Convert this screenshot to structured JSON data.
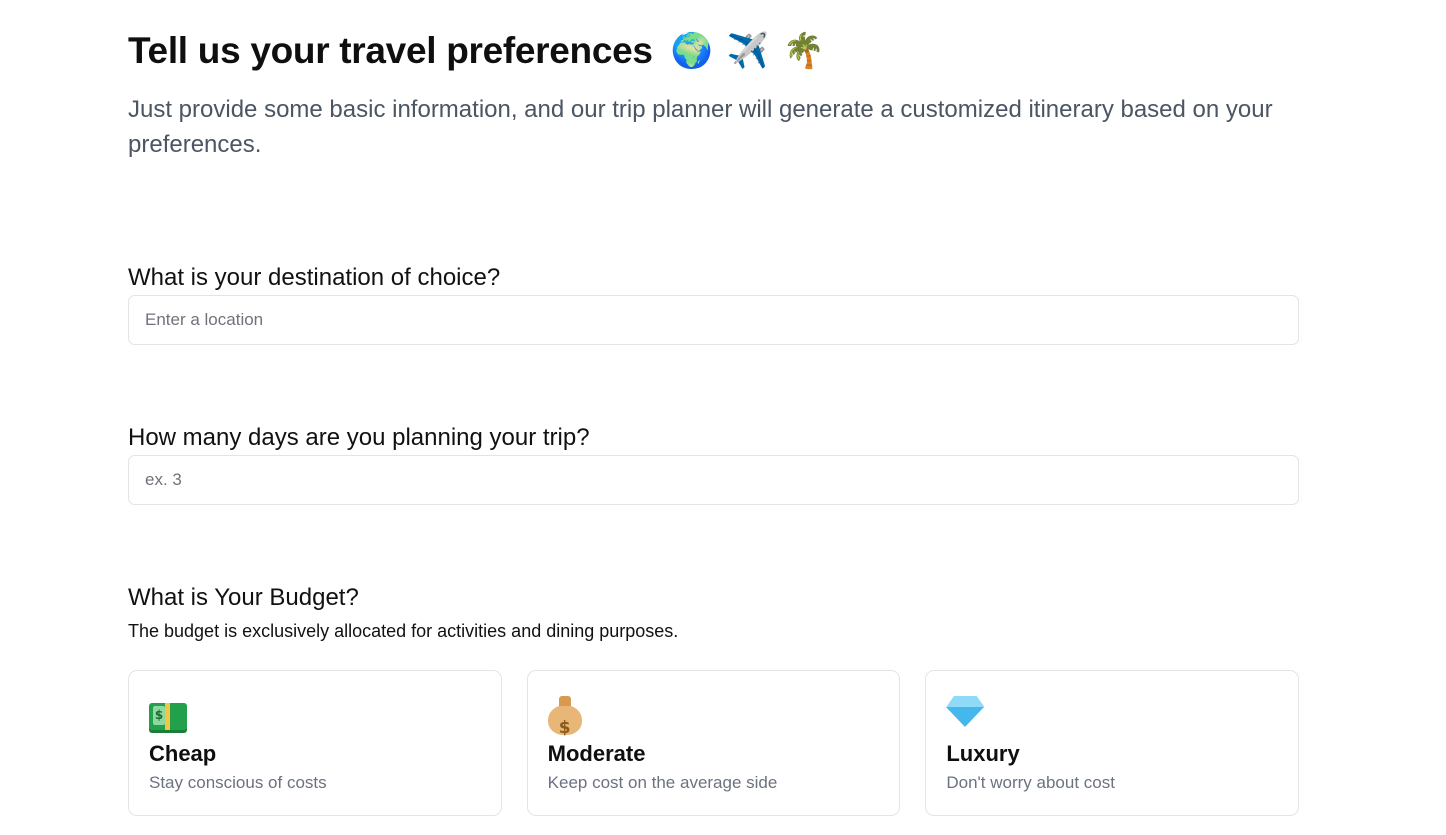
{
  "header": {
    "title": "Tell us your travel preferences",
    "title_icons": [
      "🌍",
      "✈️",
      "🌴"
    ],
    "subtitle": "Just provide some basic information, and our trip planner will generate a customized itinerary based on your preferences."
  },
  "destination": {
    "label": "What is your destination of choice?",
    "placeholder": "Enter a location",
    "value": ""
  },
  "days": {
    "label": "How many days are you planning your trip?",
    "placeholder": "ex. 3",
    "value": ""
  },
  "budget": {
    "label": "What is Your Budget?",
    "description": "The budget is exclusively allocated for activities and dining purposes.",
    "options": [
      {
        "icon": "banknote-icon",
        "title": "Cheap",
        "desc": "Stay conscious of costs"
      },
      {
        "icon": "money-bag-icon",
        "title": "Moderate",
        "desc": "Keep cost on the average side"
      },
      {
        "icon": "gem-icon",
        "title": "Luxury",
        "desc": "Don't worry about cost"
      }
    ]
  },
  "colors": {
    "border": "#e4e4e7",
    "muted_text": "#6b7280",
    "subtitle_text": "#4b5563"
  }
}
